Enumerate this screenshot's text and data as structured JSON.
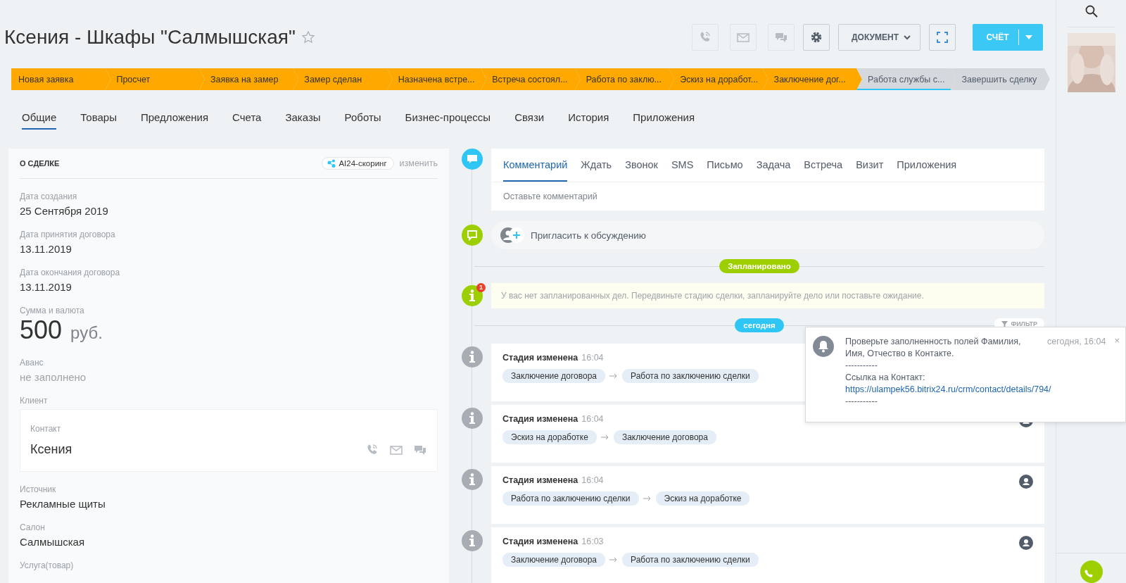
{
  "header": {
    "title": "Ксения - Шкафы \"Салмышская\"",
    "starred": false,
    "document_button": "ДОКУМЕНТ",
    "invoice_button": "СЧЁТ"
  },
  "stages": [
    {
      "label": "Новая заявка",
      "kind": "done",
      "selected": false
    },
    {
      "label": "Просчет",
      "kind": "done",
      "selected": false
    },
    {
      "label": "Заявка на замер",
      "kind": "done",
      "selected": false
    },
    {
      "label": "Замер сделан",
      "kind": "done",
      "selected": false
    },
    {
      "label": "Назначена встре...",
      "kind": "done",
      "selected": false
    },
    {
      "label": "Встреча состоял...",
      "kind": "done",
      "selected": false
    },
    {
      "label": "Работа по заклю...",
      "kind": "done",
      "selected": false
    },
    {
      "label": "Эскиз на доработ...",
      "kind": "done",
      "selected": false
    },
    {
      "label": "Заключение дог...",
      "kind": "done",
      "selected": false
    },
    {
      "label": "Работа службы с...",
      "kind": "pending",
      "selected": true
    },
    {
      "label": "Завершить сделку",
      "kind": "final",
      "selected": false
    }
  ],
  "tabs": [
    {
      "label": "Общие",
      "selected": true
    },
    {
      "label": "Товары",
      "selected": false
    },
    {
      "label": "Предложения",
      "selected": false
    },
    {
      "label": "Счета",
      "selected": false
    },
    {
      "label": "Заказы",
      "selected": false
    },
    {
      "label": "Роботы",
      "selected": false
    },
    {
      "label": "Бизнес-процессы",
      "selected": false
    },
    {
      "label": "Связи",
      "selected": false
    },
    {
      "label": "История",
      "selected": false
    },
    {
      "label": "Приложения",
      "selected": false
    }
  ],
  "deal": {
    "title": "О СДЕЛКЕ",
    "scoring_button": "AI24-скоринг",
    "edit_link": "изменить",
    "fields": [
      {
        "label": "Дата создания",
        "value": "25 Сентября 2019",
        "kind": "text"
      },
      {
        "label": "Дата принятия договора",
        "value": "13.11.2019",
        "kind": "text"
      },
      {
        "label": "Дата окончания договора",
        "value": "13.11.2019",
        "kind": "text"
      },
      {
        "label": "Сумма и валюта",
        "value": "500",
        "currency": "руб.",
        "kind": "money"
      },
      {
        "label": "Аванс",
        "value": "не заполнено",
        "kind": "empty"
      },
      {
        "label": "Клиент",
        "kind": "client",
        "contact_label": "Контакт",
        "contact_name": "Ксения"
      },
      {
        "label": "Источник",
        "value": "Рекламные щиты",
        "kind": "text"
      },
      {
        "label": "Салон",
        "value": "Салмышская",
        "kind": "text"
      },
      {
        "label": "Услуга(товар)",
        "kind": "label"
      }
    ]
  },
  "timeline": {
    "editor_tabs": [
      {
        "label": "Комментарий",
        "selected": true
      },
      {
        "label": "Ждать",
        "selected": false
      },
      {
        "label": "Звонок",
        "selected": false
      },
      {
        "label": "SMS",
        "selected": false
      },
      {
        "label": "Письмо",
        "selected": false
      },
      {
        "label": "Задача",
        "selected": false
      },
      {
        "label": "Встреча",
        "selected": false
      },
      {
        "label": "Визит",
        "selected": false
      },
      {
        "label": "Приложения",
        "selected": false
      }
    ],
    "comment_placeholder": "Оставьте комментарий",
    "invite": "Пригласить к обсуждению",
    "planned_label": "Запланировано",
    "planned_count": "1",
    "planned_note": "У вас нет запланированных дел. Передвиньте стадию сделки, запланируйте дело или поставьте ожидание.",
    "today_label": "сегодня",
    "filter_button": "ФИЛЬТР",
    "events": [
      {
        "title": "Стадия изменена",
        "time": "16:04",
        "from": "Заключение договора",
        "to": "Работа по заключению сделки"
      },
      {
        "title": "Стадия изменена",
        "time": "16:04",
        "from": "Эскиз на доработке",
        "to": "Заключение договора"
      },
      {
        "title": "Стадия изменена",
        "time": "16:04",
        "from": "Работа по заключению сделки",
        "to": "Эскиз на доработке"
      },
      {
        "title": "Стадия изменена",
        "time": "16:03",
        "from": "Заключение договора",
        "to": "Работа по заключению сделки"
      }
    ]
  },
  "notification": {
    "message": "Проверьте заполненность полей Фамилия, Имя, Отчество в Контакте.",
    "separator_top": "-----------",
    "link_label": "Ссылка на Контакт:",
    "link": "https://ulampek56.bitrix24.ru/crm/contact/details/794/",
    "separator_bottom": "-----------",
    "time": "сегодня, 16:04",
    "close": "×"
  }
}
